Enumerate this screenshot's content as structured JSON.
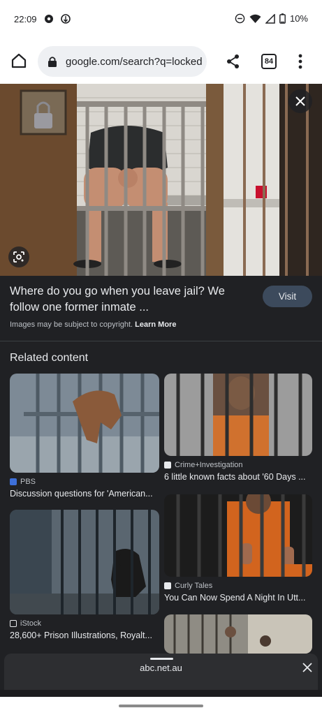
{
  "status_bar": {
    "time": "22:09",
    "battery": "10%",
    "icons": [
      "gear-icon",
      "data-saver-icon",
      "do-not-disturb-icon",
      "wifi-icon",
      "signal-icon",
      "battery-icon"
    ]
  },
  "browser": {
    "url_text": "google.com/search?q=locked",
    "tab_count": "84",
    "icons": [
      "home-icon",
      "lock-icon",
      "share-icon",
      "tabs-icon",
      "more-vert-icon"
    ]
  },
  "result": {
    "title": "Where do you go when you leave jail? We follow one former inmate ...",
    "visit_label": "Visit",
    "copyright_text": "Images may be subject to copyright.",
    "learn_more": "Learn More"
  },
  "related": {
    "heading": "Related content",
    "cards": [
      {
        "source": "PBS",
        "caption": "Discussion questions for 'American..."
      },
      {
        "source": "Crime+Investigation",
        "caption": "6 little known facts about '60 Days ..."
      },
      {
        "source": "iStock",
        "caption": "28,600+ Prison Illustrations, Royalt..."
      },
      {
        "source": "Curly Tales",
        "caption": "You Can Now Spend A Night In Utt..."
      }
    ]
  },
  "bottom_sheet": {
    "domain": "abc.net.au"
  },
  "colors": {
    "background": "#202124",
    "visit_button": "#3c4a5c",
    "text": "#e8eaed",
    "muted_text": "#bdc1c6"
  }
}
